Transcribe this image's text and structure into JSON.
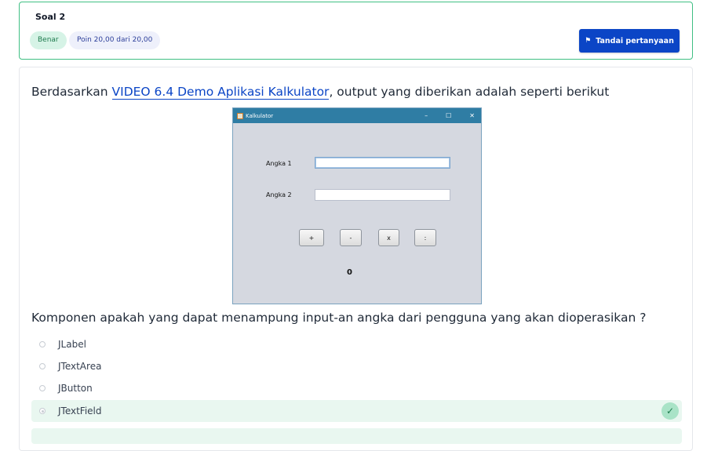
{
  "header": {
    "question_title": "Soal 2",
    "status_badge": "Benar",
    "points_badge": "Poin 20,00 dari 20,00",
    "flag_button": "Tandai pertanyaan"
  },
  "question": {
    "intro_prefix": "Berdasarkan ",
    "intro_link": "VIDEO 6.4 Demo Aplikasi Kalkulator",
    "intro_suffix": ", output yang diberikan adalah seperti berikut",
    "prompt": "Komponen apakah yang dapat menampung input-an angka dari pengguna yang akan dioperasikan ?"
  },
  "calculator": {
    "window_title": "Kalkulator",
    "minimize": "–",
    "maximize": "☐",
    "close": "✕",
    "label1": "Angka 1",
    "label2": "Angka 2",
    "buttons": [
      "+",
      "-",
      "x",
      ":"
    ],
    "result": "0"
  },
  "options": [
    {
      "label": "JLabel",
      "selected": false
    },
    {
      "label": "JTextArea",
      "selected": false
    },
    {
      "label": "JButton",
      "selected": false
    },
    {
      "label": "JTextField",
      "selected": true
    }
  ],
  "colors": {
    "accent": "#0b45c6",
    "correct": "#3fbf83",
    "correct_bg": "#e9f7f0"
  }
}
